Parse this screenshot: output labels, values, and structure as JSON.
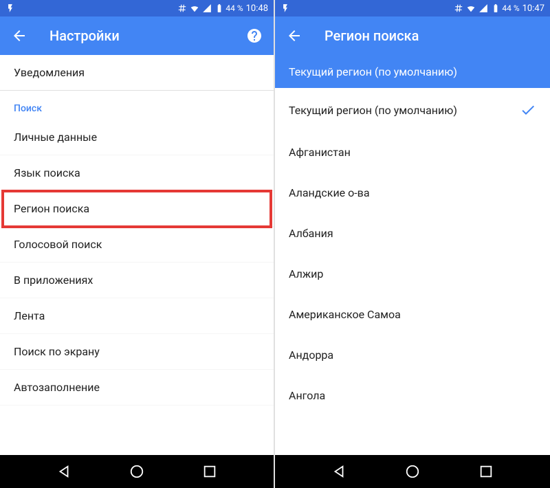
{
  "left": {
    "status": {
      "battery": "44 %",
      "time": "10:48"
    },
    "title": "Настройки",
    "notif_item": "Уведомления",
    "section": "Поиск",
    "items": [
      "Личные данные",
      "Язык поиска",
      "Регион поиска",
      "Голосовой поиск",
      "В приложениях",
      "Лента",
      "Поиск по экрану",
      "Автозаполнение"
    ],
    "highlight_index": 2
  },
  "right": {
    "status": {
      "battery": "44 %",
      "time": "10:47"
    },
    "title": "Регион поиска",
    "selected_banner": "Текущий регион (по умолчанию)",
    "regions": [
      {
        "label": "Текущий регион (по умолчанию)",
        "selected": true
      },
      {
        "label": "Афганистан",
        "selected": false
      },
      {
        "label": "Аландские о-ва",
        "selected": false
      },
      {
        "label": "Албания",
        "selected": false
      },
      {
        "label": "Алжир",
        "selected": false
      },
      {
        "label": "Американское Самоа",
        "selected": false
      },
      {
        "label": "Андорра",
        "selected": false
      },
      {
        "label": "Ангола",
        "selected": false
      }
    ]
  }
}
